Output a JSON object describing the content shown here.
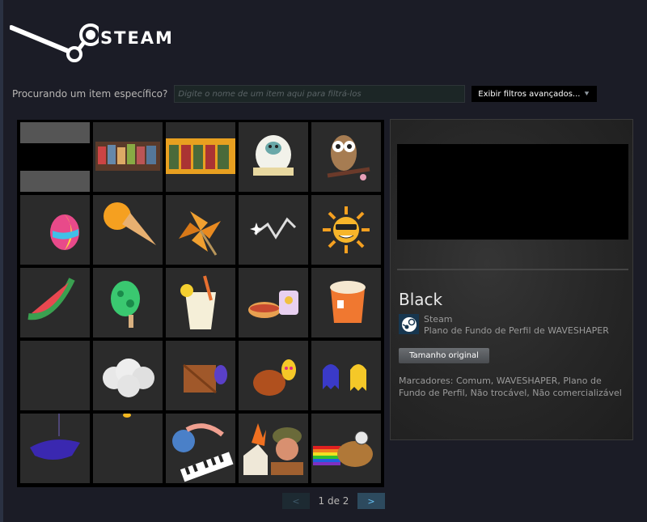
{
  "brand": {
    "wordmark": "STEAM",
    "icon": "steam-logo-icon"
  },
  "filter": {
    "label": "Procurando um item específico?",
    "placeholder": "Digite o nome de um item aqui para filtrá-los",
    "advanced_button": "Exibir filtros avançados...",
    "advanced_icon": "double-chevron-down-icon"
  },
  "inventory": {
    "items": [
      {
        "icon": "black-background-thumb-icon",
        "selected": true
      },
      {
        "icon": "team-group-art-icon"
      },
      {
        "icon": "soldiers-banner-icon"
      },
      {
        "icon": "yeti-icon"
      },
      {
        "icon": "owl-icon"
      },
      {
        "icon": "beach-ball-egg-icon"
      },
      {
        "icon": "ice-cream-cone-icon"
      },
      {
        "icon": "pinwheel-icon"
      },
      {
        "icon": "sparkle-streak-icon"
      },
      {
        "icon": "sun-sunglasses-icon"
      },
      {
        "icon": "watermelon-slice-icon"
      },
      {
        "icon": "green-popsicle-icon"
      },
      {
        "icon": "lemonade-glass-icon"
      },
      {
        "icon": "hotdog-drink-icon"
      },
      {
        "icon": "orange-cup-icon"
      },
      {
        "icon": "empty-slot-icon"
      },
      {
        "icon": "cloud-icon"
      },
      {
        "icon": "crate-ghost-icon"
      },
      {
        "icon": "pot-ghost-icon"
      },
      {
        "icon": "two-ghosts-icon"
      },
      {
        "icon": "hanging-bat-icon"
      },
      {
        "icon": "dangling-thread-icon"
      },
      {
        "icon": "pianist-keys-icon"
      },
      {
        "icon": "soldier-burning-house-icon"
      },
      {
        "icon": "rainbow-potato-icon"
      }
    ]
  },
  "detail": {
    "title": "Black",
    "game_name": "Steam",
    "game_icon": "steam-logo-icon",
    "item_type": "Plano de Fundo de Perfil de WAVESHAPER",
    "original_size_button": "Tamanho original",
    "tags": "Marcadores: Comum, WAVESHAPER, Plano de Fundo de Perfil, Não trocável, Não comercializável"
  },
  "pager": {
    "prev": "<",
    "next": ">",
    "text": "1 de 2"
  },
  "colors": {
    "page_bg": "#1b1c26",
    "accent": "#66c0f4",
    "cell_bg": "#2b2b2b"
  }
}
